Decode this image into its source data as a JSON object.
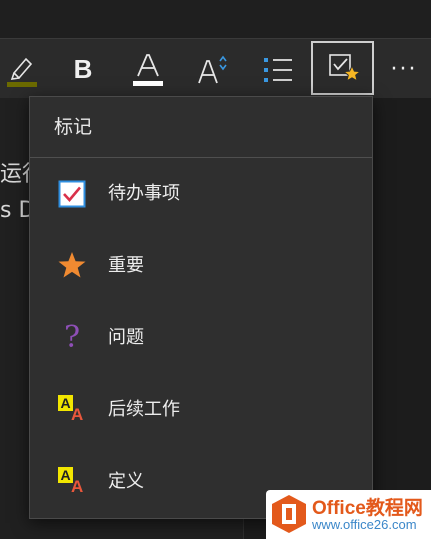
{
  "toolbar": {
    "bold_label": "B",
    "more_label": "···",
    "highlight_color": "#6b6a00",
    "font_color_bar": "#ffffff",
    "list_bullet_color": "#3a97e0"
  },
  "document": {
    "line1_fragment": "运行",
    "line2_fragment": "s D"
  },
  "menu": {
    "title": "标记",
    "items": [
      {
        "label": "待办事项",
        "icon": "checkbox-checked-icon"
      },
      {
        "label": "重要",
        "icon": "star-icon",
        "color": "#f08a31"
      },
      {
        "label": "问题",
        "icon": "question-mark-icon",
        "glyph": "?",
        "color": "#8e4fb6"
      },
      {
        "label": "后续工作",
        "icon": "follow-up-aa-icon",
        "glyph_big": "A",
        "glyph_small": "A"
      },
      {
        "label": "定义",
        "icon": "definition-aa-icon",
        "glyph_big": "A",
        "glyph_small": "A"
      }
    ]
  },
  "watermark": {
    "brand": "Office教程网",
    "url": "www.office26.com"
  }
}
